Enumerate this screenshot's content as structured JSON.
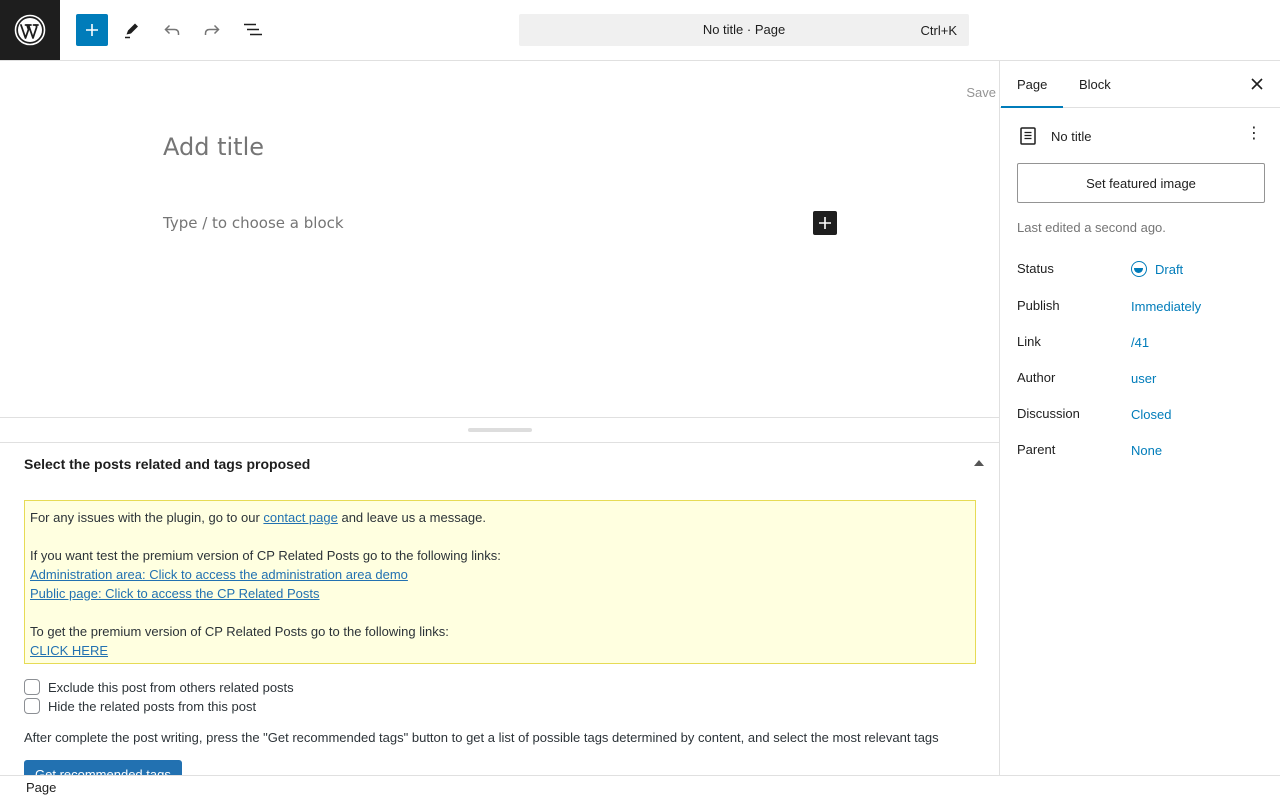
{
  "topbar": {
    "document_title": "No title · Page",
    "shortcut": "Ctrl+K"
  },
  "canvas": {
    "save_label": "Save",
    "title_placeholder": "Add title",
    "block_placeholder": "Type / to choose a block"
  },
  "metabox": {
    "title": "Select the posts related and tags proposed",
    "notice": {
      "line1_prefix": "For any issues with the plugin, go to our ",
      "line1_link": "contact page",
      "line1_suffix": " and leave us a message.",
      "line2": "If you want test the premium version of CP Related Posts go to the following links:",
      "admin_link": "Administration area: Click to access the administration area demo",
      "public_link": "Public page: Click to access the CP Related Posts",
      "line3": "To get the premium version of CP Related Posts go to the following links:",
      "click_here": "CLICK HERE"
    },
    "checkboxes": [
      {
        "label": "Exclude this post from others related posts",
        "checked": false
      },
      {
        "label": "Hide the related posts from this post",
        "checked": false
      }
    ],
    "recommend_text": "After complete the post writing, press the \"Get recommended tags\" button to get a list of possible tags determined by content, and select the most relevant tags",
    "recommend_button": "Get recommended tags"
  },
  "footer": {
    "breadcrumb": "Page"
  },
  "sidebar": {
    "tabs": [
      {
        "label": "Page",
        "active": true
      },
      {
        "label": "Block",
        "active": false
      }
    ],
    "doc_title": "No title",
    "featured_button": "Set featured image",
    "last_edited": "Last edited a second ago.",
    "properties": [
      {
        "label": "Status",
        "value": "Draft"
      },
      {
        "label": "Publish",
        "value": "Immediately"
      },
      {
        "label": "Link",
        "value": "/41"
      },
      {
        "label": "Author",
        "value": "user"
      },
      {
        "label": "Discussion",
        "value": "Closed"
      },
      {
        "label": "Parent",
        "value": "None"
      }
    ]
  },
  "colors": {
    "accent": "#007cba",
    "dark": "#1e1e1e",
    "notice_bg": "#ffffe0",
    "notice_border": "#e6db55"
  },
  "icons": {
    "logo": "wordpress-logo-icon",
    "add": "plus-icon",
    "tools": "pencil-icon",
    "undo": "undo-icon",
    "redo": "redo-icon",
    "list_view": "list-view-icon",
    "close": "close-icon",
    "document": "page-document-icon",
    "more": "more-vertical-icon",
    "status": "draft-status-icon"
  }
}
